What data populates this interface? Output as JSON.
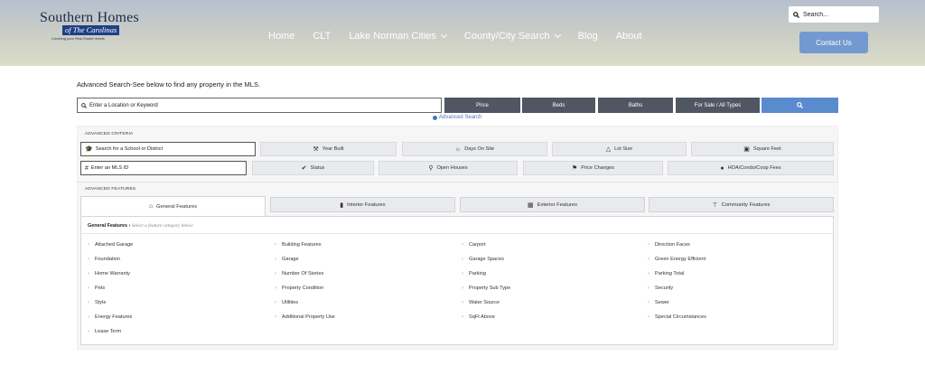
{
  "header": {
    "logo_main": "Southern Homes",
    "logo_sub": "of The Carolinas",
    "logo_tag": "Covering your Real Estate needs",
    "nav": [
      "Home",
      "CLT",
      "Lake Norman Cities",
      "County/City Search",
      "Blog",
      "About"
    ],
    "search_placeholder": "Search...",
    "contact_label": "Contact Us"
  },
  "search": {
    "heading": "Advanced Search-See below to find any property in the MLS.",
    "location_placeholder": "Enter a Location or Keyword",
    "price_label": "Price",
    "beds_label": "Beds",
    "baths_label": "Baths",
    "type_label": "For Sale / All Types",
    "advanced_link": "Advanced Search"
  },
  "criteria": {
    "label": "ADVANCED CRITERIA",
    "school_placeholder": "Search for a School or District",
    "mls_placeholder": "Enter an MLS ID",
    "row1": [
      "Year Built",
      "Days On Site",
      "Lot Size",
      "Square Feet"
    ],
    "row2": [
      "Status",
      "Open Houses",
      "Price Changes",
      "HOA/Condo/Coop Fees"
    ]
  },
  "features": {
    "label": "ADVANCED FEATURES",
    "tabs": [
      "General Features",
      "Interior Features",
      "Exterior Features",
      "Community Features"
    ],
    "active_tab": "General Features",
    "crumb_title": "General Features",
    "crumb_hint": "Select a feature category below",
    "col1": [
      "Attached Garage",
      "Foundation",
      "Home Warranty",
      "Pets",
      "Style",
      "Energy Features",
      "Lease Term"
    ],
    "col2": [
      "Building Features",
      "Garage",
      "Number Of Stories",
      "Property Condition",
      "Utilities",
      "Additional Property Use"
    ],
    "col3": [
      "Carport",
      "Garage Spaces",
      "Parking",
      "Property Sub Type",
      "Water Source",
      "SqFt Above"
    ],
    "col4": [
      "Direction Faces",
      "Green Energy Efficient",
      "Parking Total",
      "Security",
      "Sewer",
      "Special Circumstances"
    ]
  },
  "colors": {
    "accent_blue": "#5b8bcf",
    "dark_button": "#505662",
    "contact_button": "#7399d1"
  }
}
